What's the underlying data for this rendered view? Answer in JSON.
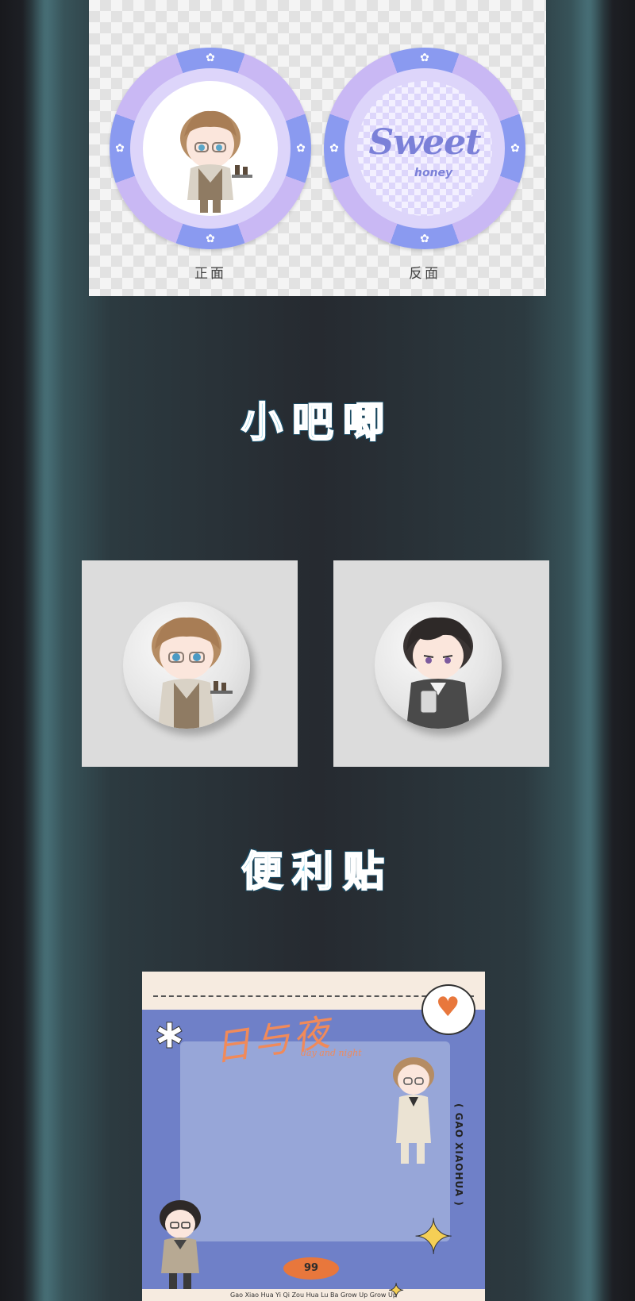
{
  "chips": {
    "front_label": "正面",
    "back_label": "反面",
    "back_art_text": "Sweet",
    "back_art_subtext": "honey"
  },
  "sections": {
    "badges_title": "小吧唧",
    "sticky_title": "便利贴"
  },
  "sticky_note": {
    "logo_text": "日与夜",
    "logo_subtext": "day and night",
    "vertical_text": "( GAO XIAOHUA )",
    "number_badge": "99",
    "footer_text": "Gao Xiao Hua Yi Qi Zou Hua Lu Ba Grow Up Grow Up"
  },
  "colors": {
    "chip_outer": "#8a9af0",
    "chip_ring": "#c9b8f4",
    "title_fill": "#6fc3dc",
    "sticky_blue": "#6f80c8",
    "accent_orange": "#e8773c",
    "star_yellow": "#f5cf55"
  }
}
